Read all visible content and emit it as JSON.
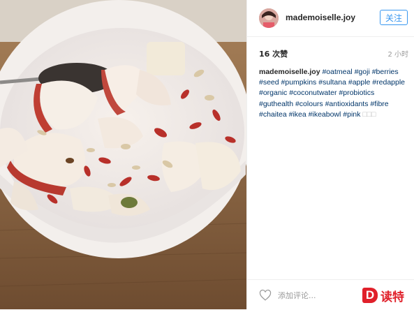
{
  "post": {
    "username": "mademoiselle.joy",
    "follow_label": "关注",
    "likes": "16 次赞",
    "time": "2 小时",
    "caption_user": "mademoiselle.joy",
    "hashtags": [
      "#oatmeal",
      "#goji",
      "#berries",
      "#seed",
      "#pumpkins",
      "#sultana",
      "#apple",
      "#redapple",
      "#organic",
      "#coconutwater",
      "#probiotics",
      "#guthealth",
      "#colours",
      "#antioxidants",
      "#fibre",
      "#chaitea",
      "#ikea",
      "#ikeabowl",
      "#pink"
    ],
    "trailing": "□□□",
    "comment_placeholder": "添加评论..."
  },
  "watermark": {
    "logo_letter": "D",
    "text": "读特"
  },
  "icons": {
    "like": "heart-icon",
    "avatar": "avatar"
  },
  "colors": {
    "accent": "#3897f0",
    "link": "#003569",
    "watermark": "#e0202a"
  }
}
